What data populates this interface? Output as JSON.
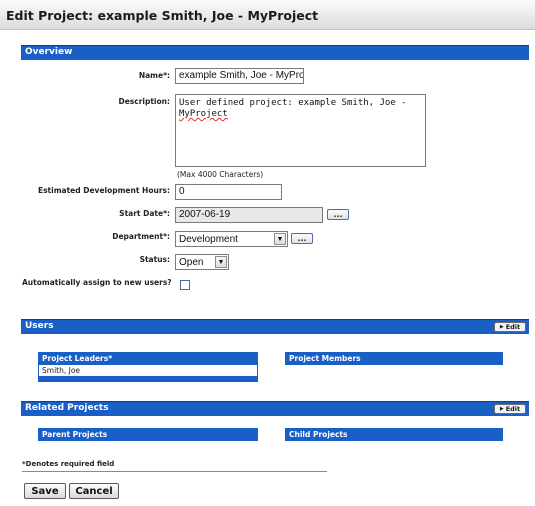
{
  "window": {
    "title": "Edit Project: example Smith, Joe - MyProject"
  },
  "overview": {
    "section_label": "Overview",
    "name": {
      "label": "Name*:",
      "value": "example Smith, Joe - MyProje"
    },
    "description": {
      "label": "Description:",
      "line1": "User defined project: example Smith, Joe -",
      "line2": "MyProject",
      "note": "(Max 4000 Characters)"
    },
    "hours": {
      "label": "Estimated Development Hours:",
      "value": "0"
    },
    "start_date": {
      "label": "Start Date*:",
      "value": "2007-06-19",
      "picker_label": "..."
    },
    "department": {
      "label": "Department*:",
      "value": "Development",
      "picker_label": "..."
    },
    "status": {
      "label": "Status:",
      "value": "Open"
    },
    "auto_assign": {
      "label": "Automatically assign to new users?",
      "checked": false
    }
  },
  "users": {
    "section_label": "Users",
    "edit_label": "Edit",
    "leaders_header": "Project Leaders*",
    "leaders": [
      "Smith, Joe"
    ],
    "members_header": "Project Members"
  },
  "related": {
    "section_label": "Related Projects",
    "edit_label": "Edit",
    "parent_header": "Parent Projects",
    "child_header": "Child Projects"
  },
  "footer": {
    "required_note": "*Denotes required field",
    "save_label": "Save",
    "cancel_label": "Cancel"
  }
}
